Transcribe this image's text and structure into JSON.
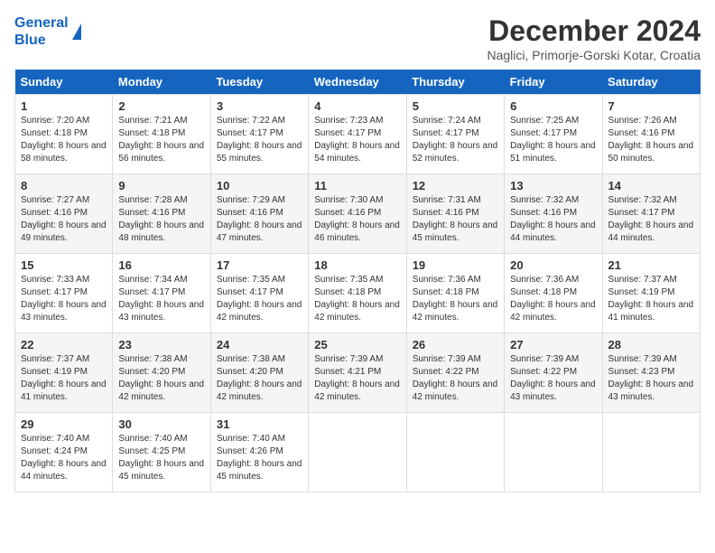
{
  "header": {
    "logo_line1": "General",
    "logo_line2": "Blue",
    "month_title": "December 2024",
    "location": "Naglici, Primorje-Gorski Kotar, Croatia"
  },
  "days_of_week": [
    "Sunday",
    "Monday",
    "Tuesday",
    "Wednesday",
    "Thursday",
    "Friday",
    "Saturday"
  ],
  "weeks": [
    [
      {
        "day": "1",
        "sunrise": "Sunrise: 7:20 AM",
        "sunset": "Sunset: 4:18 PM",
        "daylight": "Daylight: 8 hours and 58 minutes."
      },
      {
        "day": "2",
        "sunrise": "Sunrise: 7:21 AM",
        "sunset": "Sunset: 4:18 PM",
        "daylight": "Daylight: 8 hours and 56 minutes."
      },
      {
        "day": "3",
        "sunrise": "Sunrise: 7:22 AM",
        "sunset": "Sunset: 4:17 PM",
        "daylight": "Daylight: 8 hours and 55 minutes."
      },
      {
        "day": "4",
        "sunrise": "Sunrise: 7:23 AM",
        "sunset": "Sunset: 4:17 PM",
        "daylight": "Daylight: 8 hours and 54 minutes."
      },
      {
        "day": "5",
        "sunrise": "Sunrise: 7:24 AM",
        "sunset": "Sunset: 4:17 PM",
        "daylight": "Daylight: 8 hours and 52 minutes."
      },
      {
        "day": "6",
        "sunrise": "Sunrise: 7:25 AM",
        "sunset": "Sunset: 4:17 PM",
        "daylight": "Daylight: 8 hours and 51 minutes."
      },
      {
        "day": "7",
        "sunrise": "Sunrise: 7:26 AM",
        "sunset": "Sunset: 4:16 PM",
        "daylight": "Daylight: 8 hours and 50 minutes."
      }
    ],
    [
      {
        "day": "8",
        "sunrise": "Sunrise: 7:27 AM",
        "sunset": "Sunset: 4:16 PM",
        "daylight": "Daylight: 8 hours and 49 minutes."
      },
      {
        "day": "9",
        "sunrise": "Sunrise: 7:28 AM",
        "sunset": "Sunset: 4:16 PM",
        "daylight": "Daylight: 8 hours and 48 minutes."
      },
      {
        "day": "10",
        "sunrise": "Sunrise: 7:29 AM",
        "sunset": "Sunset: 4:16 PM",
        "daylight": "Daylight: 8 hours and 47 minutes."
      },
      {
        "day": "11",
        "sunrise": "Sunrise: 7:30 AM",
        "sunset": "Sunset: 4:16 PM",
        "daylight": "Daylight: 8 hours and 46 minutes."
      },
      {
        "day": "12",
        "sunrise": "Sunrise: 7:31 AM",
        "sunset": "Sunset: 4:16 PM",
        "daylight": "Daylight: 8 hours and 45 minutes."
      },
      {
        "day": "13",
        "sunrise": "Sunrise: 7:32 AM",
        "sunset": "Sunset: 4:16 PM",
        "daylight": "Daylight: 8 hours and 44 minutes."
      },
      {
        "day": "14",
        "sunrise": "Sunrise: 7:32 AM",
        "sunset": "Sunset: 4:17 PM",
        "daylight": "Daylight: 8 hours and 44 minutes."
      }
    ],
    [
      {
        "day": "15",
        "sunrise": "Sunrise: 7:33 AM",
        "sunset": "Sunset: 4:17 PM",
        "daylight": "Daylight: 8 hours and 43 minutes."
      },
      {
        "day": "16",
        "sunrise": "Sunrise: 7:34 AM",
        "sunset": "Sunset: 4:17 PM",
        "daylight": "Daylight: 8 hours and 43 minutes."
      },
      {
        "day": "17",
        "sunrise": "Sunrise: 7:35 AM",
        "sunset": "Sunset: 4:17 PM",
        "daylight": "Daylight: 8 hours and 42 minutes."
      },
      {
        "day": "18",
        "sunrise": "Sunrise: 7:35 AM",
        "sunset": "Sunset: 4:18 PM",
        "daylight": "Daylight: 8 hours and 42 minutes."
      },
      {
        "day": "19",
        "sunrise": "Sunrise: 7:36 AM",
        "sunset": "Sunset: 4:18 PM",
        "daylight": "Daylight: 8 hours and 42 minutes."
      },
      {
        "day": "20",
        "sunrise": "Sunrise: 7:36 AM",
        "sunset": "Sunset: 4:18 PM",
        "daylight": "Daylight: 8 hours and 42 minutes."
      },
      {
        "day": "21",
        "sunrise": "Sunrise: 7:37 AM",
        "sunset": "Sunset: 4:19 PM",
        "daylight": "Daylight: 8 hours and 41 minutes."
      }
    ],
    [
      {
        "day": "22",
        "sunrise": "Sunrise: 7:37 AM",
        "sunset": "Sunset: 4:19 PM",
        "daylight": "Daylight: 8 hours and 41 minutes."
      },
      {
        "day": "23",
        "sunrise": "Sunrise: 7:38 AM",
        "sunset": "Sunset: 4:20 PM",
        "daylight": "Daylight: 8 hours and 42 minutes."
      },
      {
        "day": "24",
        "sunrise": "Sunrise: 7:38 AM",
        "sunset": "Sunset: 4:20 PM",
        "daylight": "Daylight: 8 hours and 42 minutes."
      },
      {
        "day": "25",
        "sunrise": "Sunrise: 7:39 AM",
        "sunset": "Sunset: 4:21 PM",
        "daylight": "Daylight: 8 hours and 42 minutes."
      },
      {
        "day": "26",
        "sunrise": "Sunrise: 7:39 AM",
        "sunset": "Sunset: 4:22 PM",
        "daylight": "Daylight: 8 hours and 42 minutes."
      },
      {
        "day": "27",
        "sunrise": "Sunrise: 7:39 AM",
        "sunset": "Sunset: 4:22 PM",
        "daylight": "Daylight: 8 hours and 43 minutes."
      },
      {
        "day": "28",
        "sunrise": "Sunrise: 7:39 AM",
        "sunset": "Sunset: 4:23 PM",
        "daylight": "Daylight: 8 hours and 43 minutes."
      }
    ],
    [
      {
        "day": "29",
        "sunrise": "Sunrise: 7:40 AM",
        "sunset": "Sunset: 4:24 PM",
        "daylight": "Daylight: 8 hours and 44 minutes."
      },
      {
        "day": "30",
        "sunrise": "Sunrise: 7:40 AM",
        "sunset": "Sunset: 4:25 PM",
        "daylight": "Daylight: 8 hours and 45 minutes."
      },
      {
        "day": "31",
        "sunrise": "Sunrise: 7:40 AM",
        "sunset": "Sunset: 4:26 PM",
        "daylight": "Daylight: 8 hours and 45 minutes."
      },
      {
        "day": "",
        "sunrise": "",
        "sunset": "",
        "daylight": ""
      },
      {
        "day": "",
        "sunrise": "",
        "sunset": "",
        "daylight": ""
      },
      {
        "day": "",
        "sunrise": "",
        "sunset": "",
        "daylight": ""
      },
      {
        "day": "",
        "sunrise": "",
        "sunset": "",
        "daylight": ""
      }
    ]
  ]
}
